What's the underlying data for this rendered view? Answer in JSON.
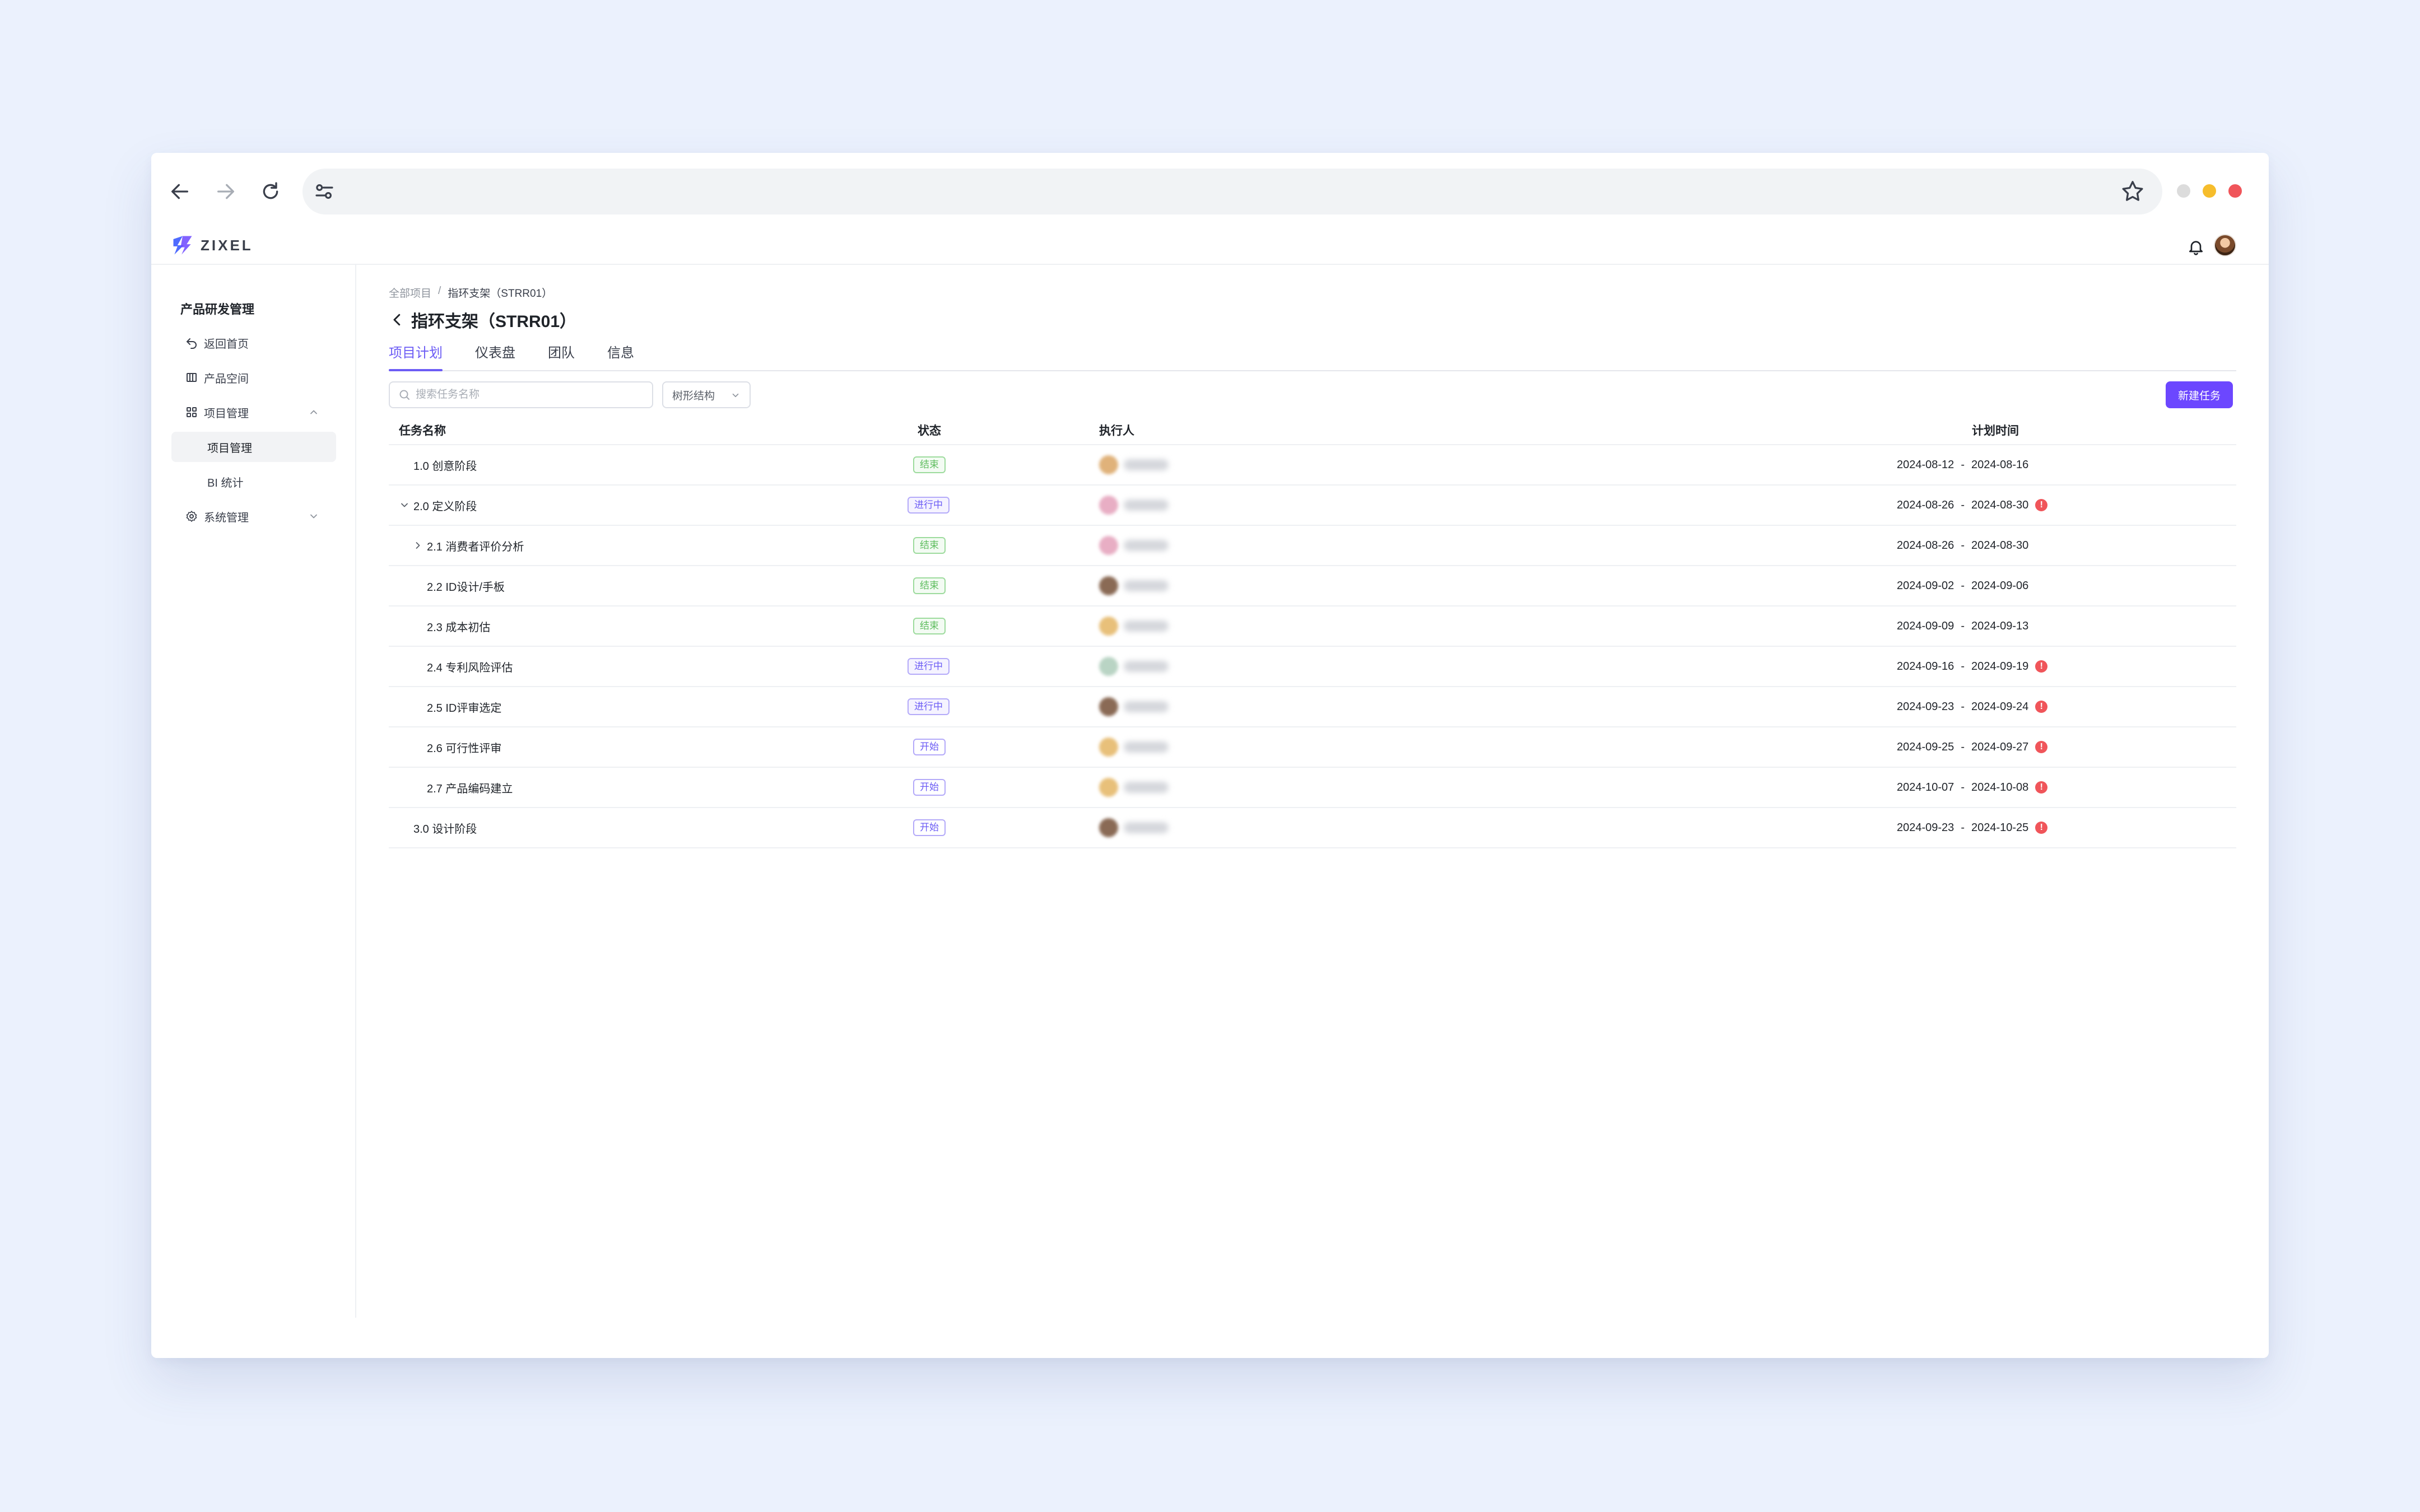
{
  "app": {
    "logo_text": "ZIXEL",
    "sidebar_title": "产品研发管理"
  },
  "sidebar": {
    "items": [
      {
        "label": "返回首页",
        "icon": "return-icon"
      },
      {
        "label": "产品空间",
        "icon": "book-icon"
      },
      {
        "label": "项目管理",
        "icon": "grid-icon",
        "expanded": true
      },
      {
        "label": "项目管理",
        "sub": true,
        "active": true
      },
      {
        "label": "BI 统计",
        "sub": true
      },
      {
        "label": "系统管理",
        "icon": "gear-icon",
        "expanded": false
      }
    ]
  },
  "breadcrumb": {
    "root": "全部项目",
    "separator": "/",
    "current": "指环支架（STRR01）"
  },
  "page": {
    "title": "指环支架（STRR01）"
  },
  "tabs": [
    {
      "label": "项目计划",
      "active": true
    },
    {
      "label": "仪表盘"
    },
    {
      "label": "团队"
    },
    {
      "label": "信息"
    }
  ],
  "toolbar": {
    "search_placeholder": "搜索任务名称",
    "view_select": "树形结构",
    "new_task_label": "新建任务"
  },
  "table": {
    "headers": {
      "name": "任务名称",
      "status": "状态",
      "assignee": "执行人",
      "time": "计划时间"
    },
    "date_separator": "-",
    "warn_symbol": "!",
    "rows": [
      {
        "name": "1.0 创意阶段",
        "status": "结束",
        "status_type": "done",
        "start": "2024-08-12",
        "end": "2024-08-16",
        "warn": false,
        "level": 0,
        "caret": "none"
      },
      {
        "name": "2.0 定义阶段",
        "status": "进行中",
        "status_type": "prog",
        "start": "2024-08-26",
        "end": "2024-08-30",
        "warn": true,
        "level": 0,
        "caret": "down"
      },
      {
        "name": "2.1 消费者评价分析",
        "status": "结束",
        "status_type": "done",
        "start": "2024-08-26",
        "end": "2024-08-30",
        "warn": false,
        "level": 1,
        "caret": "right"
      },
      {
        "name": "2.2 ID设计/手板",
        "status": "结束",
        "status_type": "done",
        "start": "2024-09-02",
        "end": "2024-09-06",
        "warn": false,
        "level": 1,
        "caret": "none"
      },
      {
        "name": "2.3 成本初估",
        "status": "结束",
        "status_type": "done",
        "start": "2024-09-09",
        "end": "2024-09-13",
        "warn": false,
        "level": 1,
        "caret": "none"
      },
      {
        "name": "2.4 专利风险评估",
        "status": "进行中",
        "status_type": "prog",
        "start": "2024-09-16",
        "end": "2024-09-19",
        "warn": true,
        "level": 1,
        "caret": "none"
      },
      {
        "name": "2.5 ID评审选定",
        "status": "进行中",
        "status_type": "prog",
        "start": "2024-09-23",
        "end": "2024-09-24",
        "warn": true,
        "level": 1,
        "caret": "none"
      },
      {
        "name": "2.6 可行性评审",
        "status": "开始",
        "status_type": "start",
        "start": "2024-09-25",
        "end": "2024-09-27",
        "warn": true,
        "level": 1,
        "caret": "none"
      },
      {
        "name": "2.7 产品编码建立",
        "status": "开始",
        "status_type": "start",
        "start": "2024-10-07",
        "end": "2024-10-08",
        "warn": true,
        "level": 1,
        "caret": "none"
      },
      {
        "name": "3.0 设计阶段",
        "status": "开始",
        "status_type": "start",
        "start": "2024-09-23",
        "end": "2024-10-25",
        "warn": true,
        "level": 0,
        "caret": "none"
      }
    ]
  },
  "colors": {
    "accent": "#6c47ff",
    "tab_active": "#6c5cf5",
    "done": "#5fbd5f",
    "warning": "#f0555a",
    "traffic_gray": "#dcdcdc",
    "traffic_yellow": "#f6bd2c",
    "traffic_red": "#f0555a"
  }
}
